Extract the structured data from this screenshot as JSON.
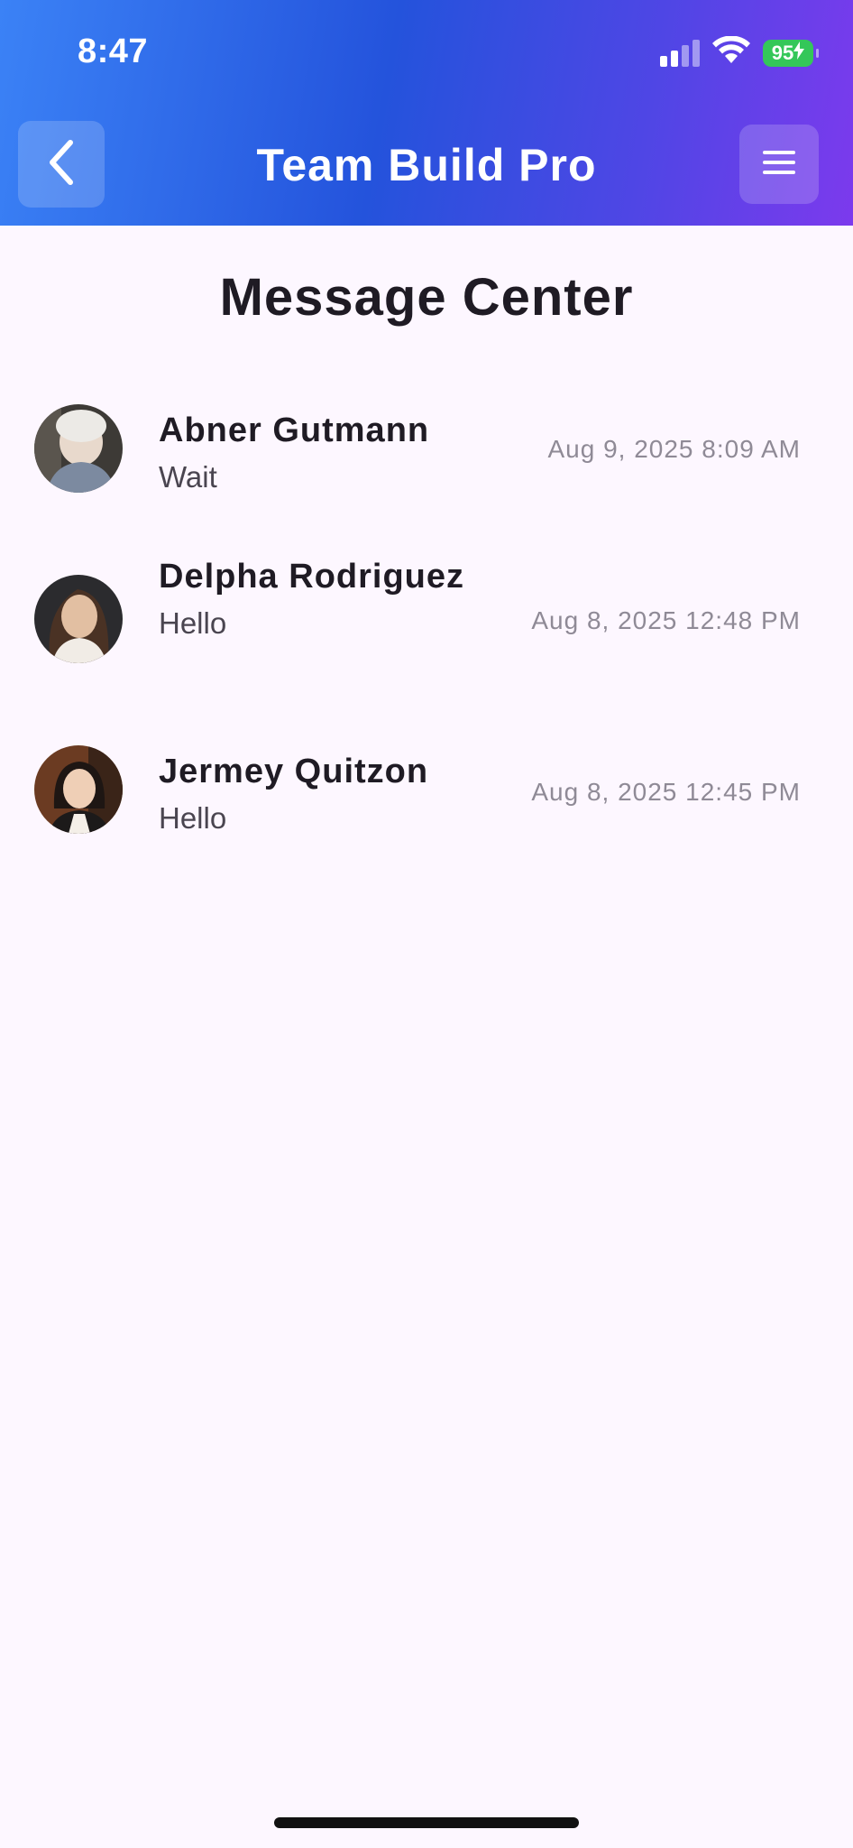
{
  "status_bar": {
    "time": "8:47",
    "battery_level": "95",
    "signal_icon": "cellular-signal-icon",
    "wifi_icon": "wifi-icon",
    "charging_icon": "charging-bolt-icon"
  },
  "header": {
    "title": "Team Build Pro",
    "back_icon": "chevron-left-icon",
    "menu_icon": "hamburger-menu-icon",
    "gradient_colors": [
      "#3b82f6",
      "#2453dc",
      "#4f46e5",
      "#7c3aed"
    ]
  },
  "page": {
    "title": "Message Center"
  },
  "conversations": [
    {
      "name": "Abner Gutmann",
      "preview": "Wait",
      "timestamp": "Aug 9, 2025 8:09 AM",
      "avatar": "avatar-photo"
    },
    {
      "name": "Delpha Rodriguez",
      "preview": "Hello",
      "timestamp": "Aug 8, 2025 12:48 PM",
      "avatar": "avatar-photo"
    },
    {
      "name": "Jermey Quitzon",
      "preview": "Hello",
      "timestamp": "Aug 8, 2025 12:45 PM",
      "avatar": "avatar-photo"
    }
  ],
  "colors": {
    "background": "#fdf7ff",
    "text_primary": "#1f1b24",
    "text_secondary": "#4a4550",
    "timestamp": "#8f8a96",
    "battery": "#34c759"
  }
}
